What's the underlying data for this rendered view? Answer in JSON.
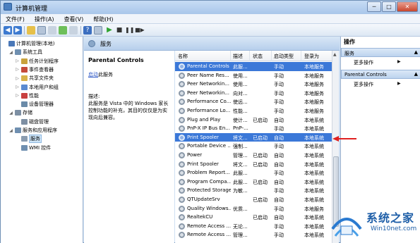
{
  "window": {
    "title": "计算机管理",
    "min": "─",
    "max": "□",
    "close": "✕"
  },
  "menu": [
    "文件(F)",
    "操作(A)",
    "查看(V)",
    "帮助(H)"
  ],
  "tree": [
    {
      "label": "计算机管理(本地)",
      "depth": 0,
      "arrow": ""
    },
    {
      "label": "系统工具",
      "depth": 1,
      "arrow": "◢"
    },
    {
      "label": "任务计划程序",
      "depth": 2,
      "arrow": "▷"
    },
    {
      "label": "事件查看器",
      "depth": 2,
      "arrow": "▷"
    },
    {
      "label": "共享文件夹",
      "depth": 2,
      "arrow": "▷"
    },
    {
      "label": "本地用户和组",
      "depth": 2,
      "arrow": "▷"
    },
    {
      "label": "性能",
      "depth": 2,
      "arrow": "▷"
    },
    {
      "label": "设备管理器",
      "depth": 2,
      "arrow": ""
    },
    {
      "label": "存储",
      "depth": 1,
      "arrow": "◢"
    },
    {
      "label": "磁盘管理",
      "depth": 2,
      "arrow": ""
    },
    {
      "label": "服务和应用程序",
      "depth": 1,
      "arrow": "◢"
    },
    {
      "label": "服务",
      "depth": 2,
      "arrow": "",
      "selected": true
    },
    {
      "label": "WMI 控件",
      "depth": 2,
      "arrow": ""
    }
  ],
  "pane": {
    "header": "服务",
    "service_title": "Parental Controls",
    "start_link": "启动",
    "start_suffix": "此服务",
    "desc_label": "描述:",
    "desc": "此服务是 Vista 中的 Windows 家长控制功能的补充，其目的仅仅是为实现向后兼容。"
  },
  "columns": [
    "名称",
    "描述",
    "状态",
    "启动类型",
    "登录为"
  ],
  "rows": [
    {
      "name": "Parental Controls",
      "desc": "此服...",
      "status": "",
      "start": "手动",
      "logon": "本地服务",
      "selected": true
    },
    {
      "name": "Peer Name Res...",
      "desc": "使用...",
      "status": "",
      "start": "手动",
      "logon": "本地服务"
    },
    {
      "name": "Peer Networkin...",
      "desc": "使用...",
      "status": "",
      "start": "手动",
      "logon": "本地服务"
    },
    {
      "name": "Peer Networkin...",
      "desc": "向对...",
      "status": "",
      "start": "手动",
      "logon": "本地服务"
    },
    {
      "name": "Performance Co...",
      "desc": "使远...",
      "status": "",
      "start": "手动",
      "logon": "本地服务"
    },
    {
      "name": "Performance Lo...",
      "desc": "性能...",
      "status": "",
      "start": "手动",
      "logon": "本地服务"
    },
    {
      "name": "Plug and Play",
      "desc": "使计...",
      "status": "已启动",
      "start": "自动",
      "logon": "本地系统"
    },
    {
      "name": "PnP-X IP Bus En...",
      "desc": "PnP-...",
      "status": "",
      "start": "手动",
      "logon": "本地系统"
    },
    {
      "name": "Print Spooler",
      "desc": "将文...",
      "status": "已启动",
      "start": "自动",
      "logon": "本地系统",
      "highlight": true
    },
    {
      "name": "Portable Device ...",
      "desc": "强制...",
      "status": "",
      "start": "手动",
      "logon": "本地系统"
    },
    {
      "name": "Power",
      "desc": "管理...",
      "status": "已启动",
      "start": "自动",
      "logon": "本地系统"
    },
    {
      "name": "Print Spooler",
      "desc": "将文...",
      "status": "已启动",
      "start": "自动",
      "logon": "本地系统"
    },
    {
      "name": "Problem Report...",
      "desc": "此服...",
      "status": "",
      "start": "手动",
      "logon": "本地系统"
    },
    {
      "name": "Program Compa...",
      "desc": "此服...",
      "status": "已启动",
      "start": "自动",
      "logon": "本地系统"
    },
    {
      "name": "Protected Storage",
      "desc": "为敏...",
      "status": "",
      "start": "手动",
      "logon": "本地系统"
    },
    {
      "name": "QTUpdateSrv",
      "desc": "",
      "status": "已启动",
      "start": "自动",
      "logon": "本地系统"
    },
    {
      "name": "Quality Windows...",
      "desc": "优质...",
      "status": "",
      "start": "手动",
      "logon": "本地服务"
    },
    {
      "name": "RealtekCU",
      "desc": "",
      "status": "已启动",
      "start": "自动",
      "logon": "本地系统"
    },
    {
      "name": "Remote Access ...",
      "desc": "无论...",
      "status": "",
      "start": "手动",
      "logon": "本地系统"
    },
    {
      "name": "Remote Access ...",
      "desc": "管理...",
      "status": "",
      "start": "手动",
      "logon": "本地系统"
    }
  ],
  "actions": {
    "title": "操作",
    "sec1": "服务",
    "sec1_item": "更多操作",
    "sec2": "Parental Controls",
    "sec2_item": "更多操作"
  },
  "watermark": {
    "brand": "系统之家",
    "site": "Win10net.com"
  },
  "colors": {
    "selected_row": "#3b78d8",
    "header_blue": "#b7cfec",
    "arrow": "#e02020"
  }
}
